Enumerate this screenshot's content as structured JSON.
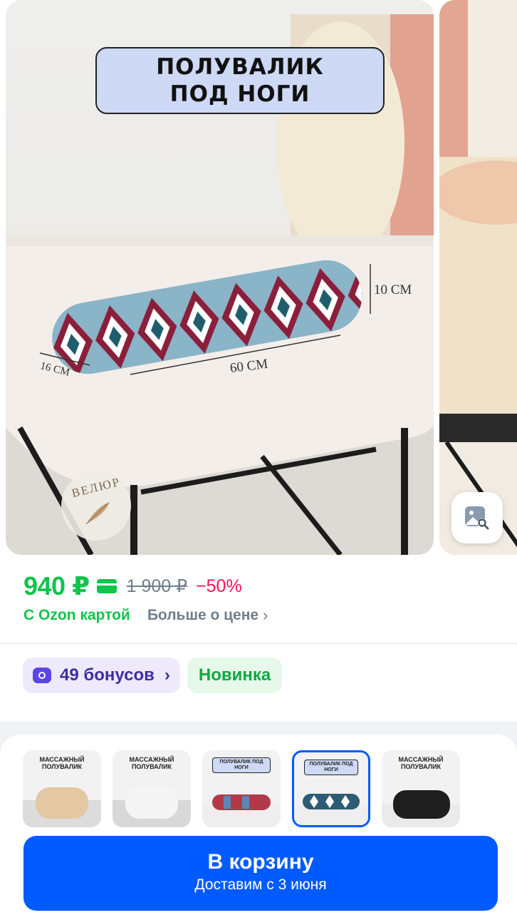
{
  "gallery": {
    "banner_title": "ПОЛУВАЛИК ПОД НОГИ",
    "dimensions": {
      "height": "10 СМ",
      "length": "60 СМ",
      "width": "16 СМ"
    },
    "badge_text": "ВЕЛЮР",
    "visual_search_icon": "image-search-icon"
  },
  "price": {
    "current": "940 ₽",
    "old": "1 900 ₽",
    "discount": "−50%",
    "ozon_card_label": "С Ozon картой",
    "more_about_price": "Больше о цене",
    "accent_color": "#10c44c",
    "discount_color": "#f91155"
  },
  "badges": {
    "bonus_label": "49 бонусов",
    "new_label": "Новинка"
  },
  "variants": [
    {
      "label": "МАССАЖНЫЙ ПОЛУВАЛИК",
      "color": "beige",
      "selected": false
    },
    {
      "label": "МАССАЖНЫЙ ПОЛУВАЛИК",
      "color": "white",
      "selected": false
    },
    {
      "label": "ПОЛУВАЛИК ПОД НОГИ",
      "color": "pattern-red-blue",
      "selected": false
    },
    {
      "label": "ПОЛУВАЛИК ПОД НОГИ",
      "color": "pattern-blue-white",
      "selected": true
    },
    {
      "label": "МАССАЖНЫЙ ПОЛУВАЛИК",
      "color": "black",
      "selected": false
    }
  ],
  "cart": {
    "button_label": "В корзину",
    "delivery_text": "Доставим с 3 июня",
    "color": "#005bff"
  }
}
